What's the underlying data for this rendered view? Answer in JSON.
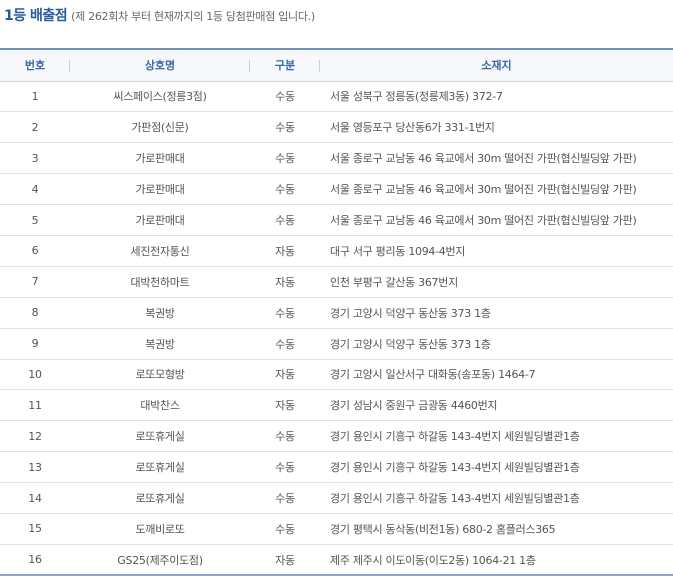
{
  "heading": {
    "title": "1등 배출점",
    "subtitle": "(제 262회차 부터 현재까지의 1등 당첨판매점 입니다.)"
  },
  "table": {
    "columns": [
      "번호",
      "상호명",
      "구분",
      "소재지"
    ],
    "rows": [
      {
        "no": "1",
        "name": "씨스페이스(정릉3점)",
        "type": "수동",
        "address": "서울 성북구 정릉동(정릉제3동) 372-7"
      },
      {
        "no": "2",
        "name": "가판점(신문)",
        "type": "수동",
        "address": "서울 영등포구 당산동6가 331-1번지"
      },
      {
        "no": "3",
        "name": "가로판매대",
        "type": "수동",
        "address": "서울 종로구 교남동 46 육교에서 30m 떨어진 가판(협신빌딩앞 가판)"
      },
      {
        "no": "4",
        "name": "가로판매대",
        "type": "수동",
        "address": "서울 종로구 교남동 46 육교에서 30m 떨어진 가판(협신빌딩앞 가판)"
      },
      {
        "no": "5",
        "name": "가로판매대",
        "type": "수동",
        "address": "서울 종로구 교남동 46 육교에서 30m 떨어진 가판(협신빌딩앞 가판)"
      },
      {
        "no": "6",
        "name": "세진전자통신",
        "type": "자동",
        "address": "대구 서구 평리동 1094-4번지"
      },
      {
        "no": "7",
        "name": "대박천하마트",
        "type": "자동",
        "address": "인천 부평구 갈산동 367번지"
      },
      {
        "no": "8",
        "name": "복권방",
        "type": "수동",
        "address": "경기 고양시 덕양구 동산동 373 1층"
      },
      {
        "no": "9",
        "name": "복권방",
        "type": "수동",
        "address": "경기 고양시 덕양구 동산동 373 1층"
      },
      {
        "no": "10",
        "name": "로또모형방",
        "type": "자동",
        "address": "경기 고양시 일산서구 대화동(송포동) 1464-7"
      },
      {
        "no": "11",
        "name": "대박찬스",
        "type": "자동",
        "address": "경기 성남시 중원구 금광동 4460번지"
      },
      {
        "no": "12",
        "name": "로또휴게실",
        "type": "수동",
        "address": "경기 용인시 기흥구 하갈동 143-4번지 세원빌딩별관1층"
      },
      {
        "no": "13",
        "name": "로또휴게실",
        "type": "수동",
        "address": "경기 용인시 기흥구 하갈동 143-4번지 세원빌딩별관1층"
      },
      {
        "no": "14",
        "name": "로또휴게실",
        "type": "수동",
        "address": "경기 용인시 기흥구 하갈동 143-4번지 세원빌딩별관1층"
      },
      {
        "no": "15",
        "name": "도깨비로또",
        "type": "수동",
        "address": "경기 평택시 동삭동(비전1동) 680-2 홈플러스365"
      },
      {
        "no": "16",
        "name": "GS25(제주이도점)",
        "type": "자동",
        "address": "제주 제주시 이도이동(이도2동) 1064-21 1층"
      }
    ]
  },
  "colors": {
    "title": "#2a5a9e",
    "header_text": "#3a68a8",
    "header_border": "#6f90bd",
    "row_border": "#e3e3e3"
  }
}
